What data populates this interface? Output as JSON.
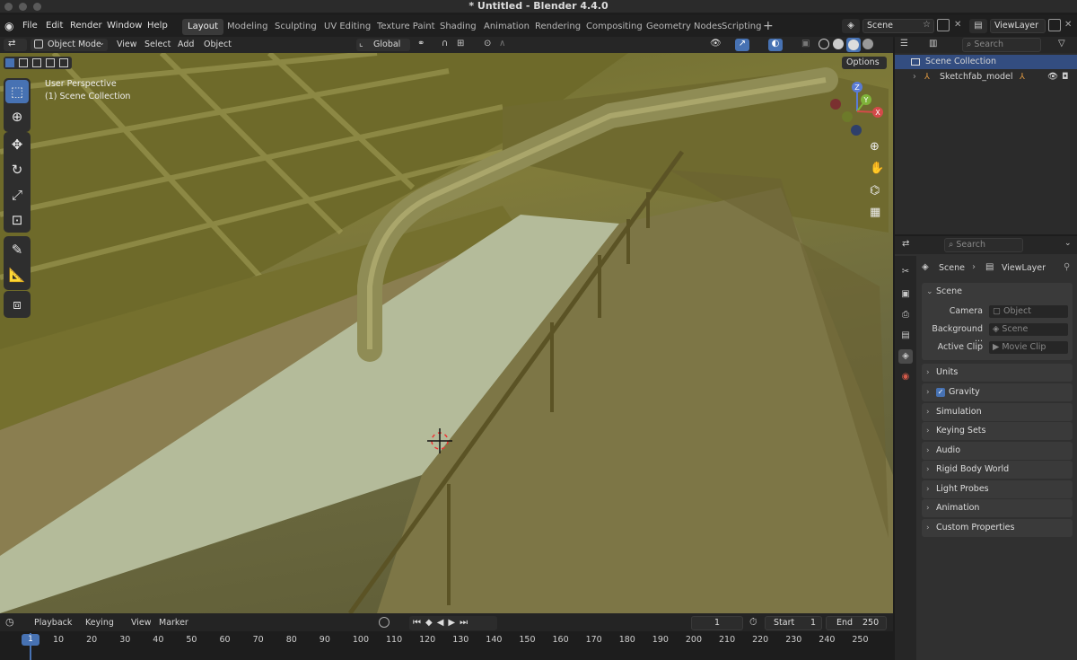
{
  "window": {
    "title": "* Untitled - Blender 4.4.0"
  },
  "menubar": {
    "menus": [
      "File",
      "Edit",
      "Render",
      "Window",
      "Help"
    ],
    "workspaces": [
      "Layout",
      "Modeling",
      "Sculpting",
      "UV Editing",
      "Texture Paint",
      "Shading",
      "Animation",
      "Rendering",
      "Compositing",
      "Geometry Nodes",
      "Scripting"
    ],
    "active_workspace": "Layout",
    "scene_name": "Scene",
    "view_layer": "ViewLayer"
  },
  "viewport_header": {
    "mode": "Object Mode",
    "menus": [
      "View",
      "Select",
      "Add",
      "Object"
    ],
    "orientation": "Global",
    "options_label": "Options"
  },
  "viewport": {
    "overlay_line1": "User Perspective",
    "overlay_line2": "(1) Scene Collection",
    "gizmo_axes": [
      "Z",
      "Y",
      "X"
    ]
  },
  "outliner": {
    "search_placeholder": "Search",
    "root": "Scene Collection",
    "items": [
      "Sketchfab_model"
    ]
  },
  "properties": {
    "search_placeholder": "Search",
    "breadcrumb_scene": "Scene",
    "breadcrumb_layer": "ViewLayer",
    "scene_panel": {
      "title": "Scene",
      "fields": [
        {
          "label": "Camera",
          "value": "Object"
        },
        {
          "label": "Background ...",
          "value": "Scene"
        },
        {
          "label": "Active Clip",
          "value": "Movie Clip"
        }
      ]
    },
    "sections": [
      "Units",
      "Gravity",
      "Simulation",
      "Keying Sets",
      "Audio",
      "Rigid Body World",
      "Light Probes",
      "Animation",
      "Custom Properties"
    ],
    "gravity_checked": true
  },
  "timeline": {
    "menus": [
      "Playback",
      "Keying",
      "View",
      "Marker"
    ],
    "current_frame": "1",
    "start_label": "Start",
    "start_value": "1",
    "end_label": "End",
    "end_value": "250",
    "ruler": [
      "1",
      "10",
      "20",
      "30",
      "40",
      "50",
      "60",
      "70",
      "80",
      "90",
      "100",
      "110",
      "120",
      "130",
      "140",
      "150",
      "160",
      "170",
      "180",
      "190",
      "200",
      "210",
      "220",
      "230",
      "240",
      "250"
    ]
  },
  "colors": {
    "accent": "#4772b3",
    "panel": "#303030",
    "header": "#262626"
  }
}
